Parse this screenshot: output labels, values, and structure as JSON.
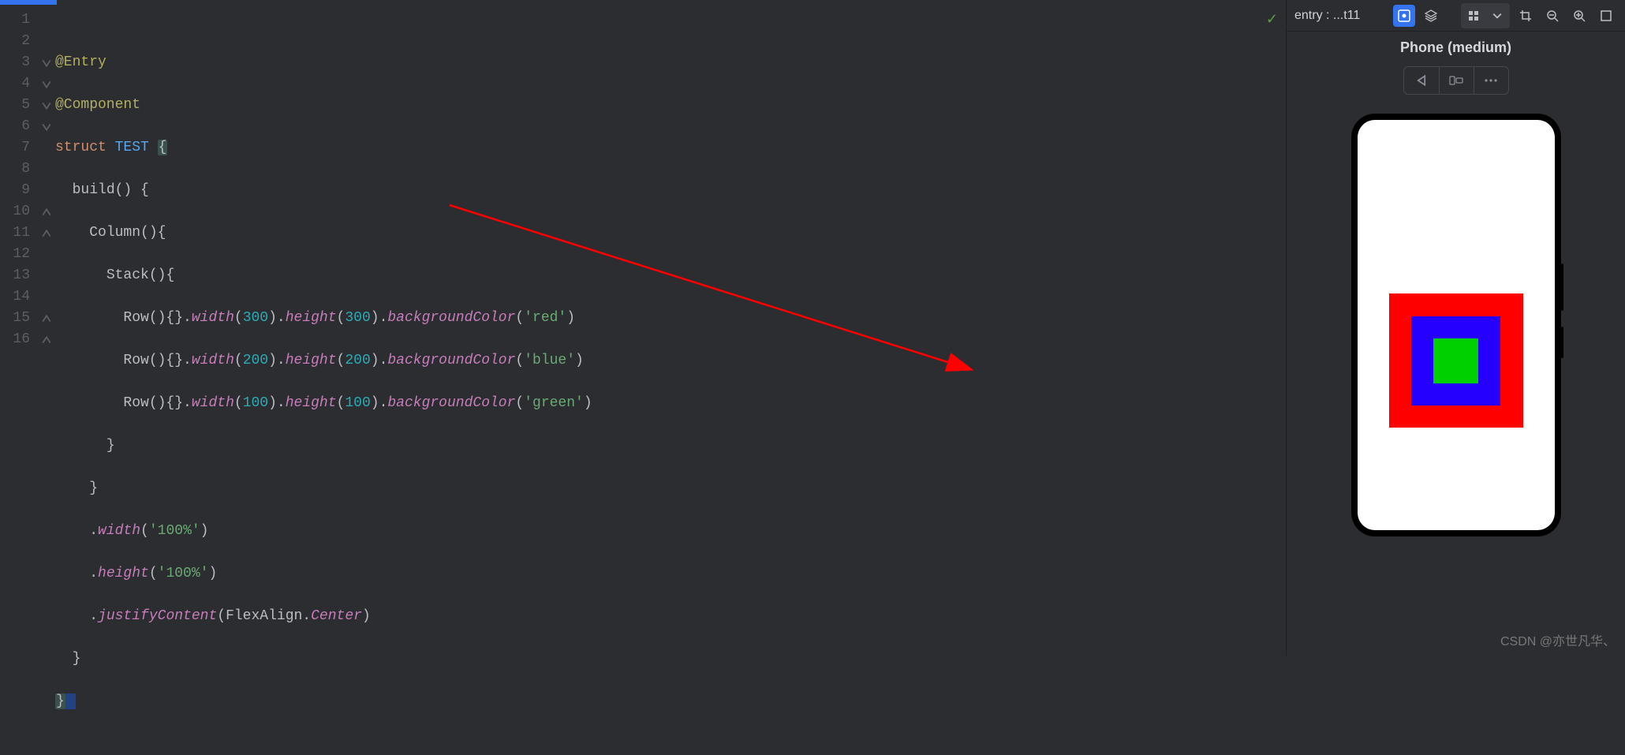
{
  "editor": {
    "lines": [
      "1",
      "2",
      "3",
      "4",
      "5",
      "6",
      "7",
      "8",
      "9",
      "10",
      "11",
      "12",
      "13",
      "14",
      "15",
      "16"
    ],
    "code": {
      "l1": "@Entry",
      "l2": "@Component",
      "l3_k": "struct",
      "l3_n": "TEST",
      "l3_b": "{",
      "l4_fn": "build",
      "l4_p": "()",
      "l4_b": "{",
      "l5_o": "Column",
      "l5_p": "()",
      "l5_b": "{",
      "l6_o": "Stack",
      "l6_p": "()",
      "l6_b": "{",
      "l7_o": "Row",
      "l7_p": "(){}",
      "l7_m1": "width",
      "l7_n1": "300",
      "l7_m2": "height",
      "l7_n2": "300",
      "l7_m3": "backgroundColor",
      "l7_s": "'red'",
      "l8_o": "Row",
      "l8_p": "(){}",
      "l8_m1": "width",
      "l8_n1": "200",
      "l8_m2": "height",
      "l8_n2": "200",
      "l8_m3": "backgroundColor",
      "l8_s": "'blue'",
      "l9_o": "Row",
      "l9_p": "(){}",
      "l9_m1": "width",
      "l9_n1": "100",
      "l9_m2": "height",
      "l9_n2": "100",
      "l9_m3": "backgroundColor",
      "l9_s": "'green'",
      "l10": "}",
      "l11": "}",
      "l12_m": "width",
      "l12_s": "'100%'",
      "l13_m": "height",
      "l13_s": "'100%'",
      "l14_m": "justifyContent",
      "l14_c": "FlexAlign",
      "l14_p": "Center",
      "l15": "}",
      "l16": "}"
    },
    "status_ok": "✓"
  },
  "preview": {
    "title": "entry : ...t11",
    "device": "Phone (medium)"
  },
  "watermark": "CSDN @亦世凡华、"
}
